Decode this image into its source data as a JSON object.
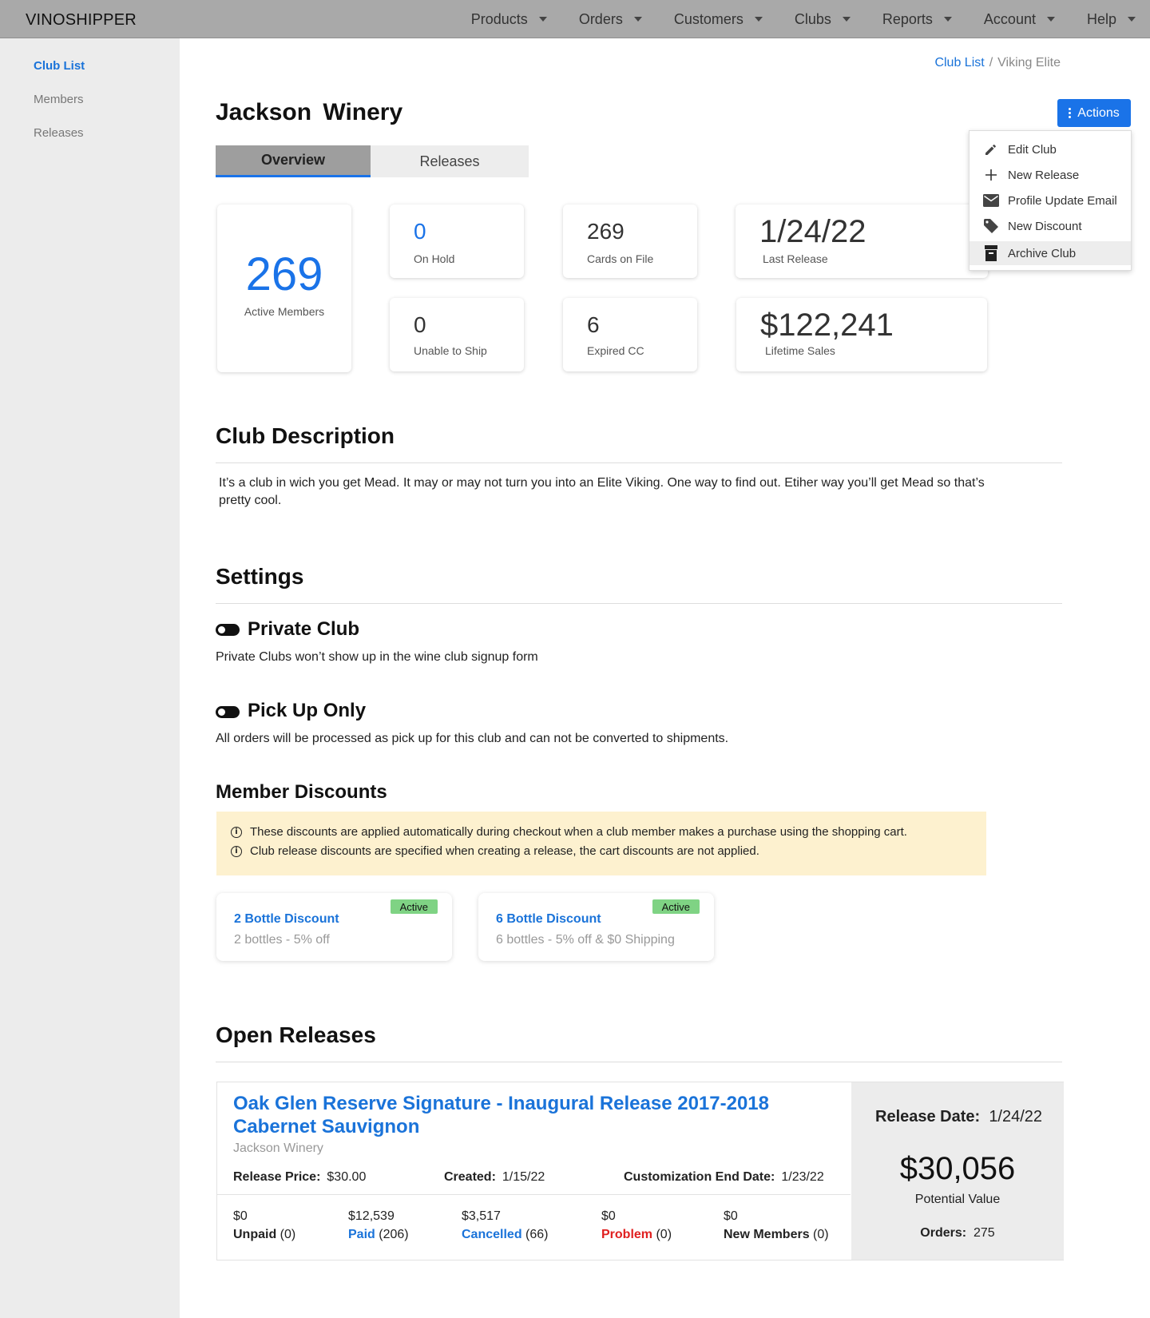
{
  "brand": "VINOSHIPPER",
  "nav": [
    "Products",
    "Orders",
    "Customers",
    "Clubs",
    "Reports",
    "Account",
    "Help"
  ],
  "sidebar": [
    {
      "label": "Club List",
      "active": true
    },
    {
      "label": "Members",
      "active": false
    },
    {
      "label": "Releases",
      "active": false
    }
  ],
  "breadcrumb": {
    "link": "Club List",
    "sep": "/",
    "current": "Viking Elite"
  },
  "page_title": "Jackson Winery",
  "actions_label": "Actions",
  "actions_menu": [
    {
      "label": "Edit Club",
      "icon": "pencil-icon"
    },
    {
      "label": "New Release",
      "icon": "plus-icon"
    },
    {
      "label": "Profile Update Email",
      "icon": "envelope-icon"
    },
    {
      "label": "New Discount",
      "icon": "tag-icon"
    },
    {
      "label": "Archive Club",
      "icon": "archive-icon"
    }
  ],
  "tabs": {
    "overview": "Overview",
    "releases": "Releases"
  },
  "stats": {
    "active_members": {
      "value": "269",
      "label": "Active Members"
    },
    "on_hold": {
      "value": "0",
      "label": "On Hold"
    },
    "cards_on_file": {
      "value": "269",
      "label": "Cards on File"
    },
    "last_release": {
      "value": "1/24/22",
      "label": "Last Release"
    },
    "unable_to_ship": {
      "value": "0",
      "label": "Unable to Ship"
    },
    "expired_cc": {
      "value": "6",
      "label": "Expired CC"
    },
    "lifetime_sales": {
      "value": "$122,241",
      "label": "Lifetime Sales"
    }
  },
  "club_description": {
    "heading": "Club Description",
    "text": "It’s a club in wich you get Mead. It may or may not turn you into an Elite Viking. One way to find out. Etiher way you’ll get Mead so that’s pretty cool."
  },
  "settings": {
    "heading": "Settings",
    "private_club": {
      "title": "Private Club",
      "note": "Private Clubs won’t show up in the wine club signup form"
    },
    "pick_up_only": {
      "title": "Pick Up Only",
      "note": "All orders will be processed as pick up for this club and can not be converted to shipments."
    }
  },
  "member_discounts": {
    "heading": "Member Discounts",
    "info": [
      "These discounts are applied automatically during checkout when a club member makes a purchase using the shopping cart.",
      "Club release discounts are specified when creating a release, the cart discounts are not applied."
    ],
    "discounts": [
      {
        "name": "2 Bottle Discount",
        "detail": "2 bottles - 5% off",
        "status": "Active"
      },
      {
        "name": "6 Bottle Discount",
        "detail": "6 bottles - 5% off & $0 Shipping",
        "status": "Active"
      }
    ]
  },
  "open_releases": {
    "heading": "Open Releases",
    "release": {
      "title": "Oak Glen Reserve Signature - Inaugural Release 2017-2018 Cabernet Sauvignon",
      "winery": "Jackson Winery",
      "release_price_label": "Release Price:",
      "release_price": "$30.00",
      "created_label": "Created:",
      "created": "1/15/22",
      "custom_end_label": "Customization End Date:",
      "custom_end": "1/23/22",
      "stats": [
        {
          "amount": "$0",
          "label": "Unpaid",
          "count": "(0)"
        },
        {
          "amount": "$12,539",
          "label": "Paid",
          "count": "(206)"
        },
        {
          "amount": "$3,517",
          "label": "Cancelled",
          "count": "(66)"
        },
        {
          "amount": "$0",
          "label": "Problem",
          "count": "(0)"
        },
        {
          "amount": "$0",
          "label": "New Members",
          "count": "(0)"
        }
      ],
      "release_date_label": "Release Date:",
      "release_date": "1/24/22",
      "potential_value": "$30,056",
      "potential_value_label": "Potential Value",
      "orders_label": "Orders:",
      "orders": "275"
    }
  },
  "colors": {
    "accent": "#1a73e8",
    "link": "#1a73d9",
    "badge": "#7fd384",
    "info_bg": "#fdf1cf",
    "problem": "#e02020"
  }
}
